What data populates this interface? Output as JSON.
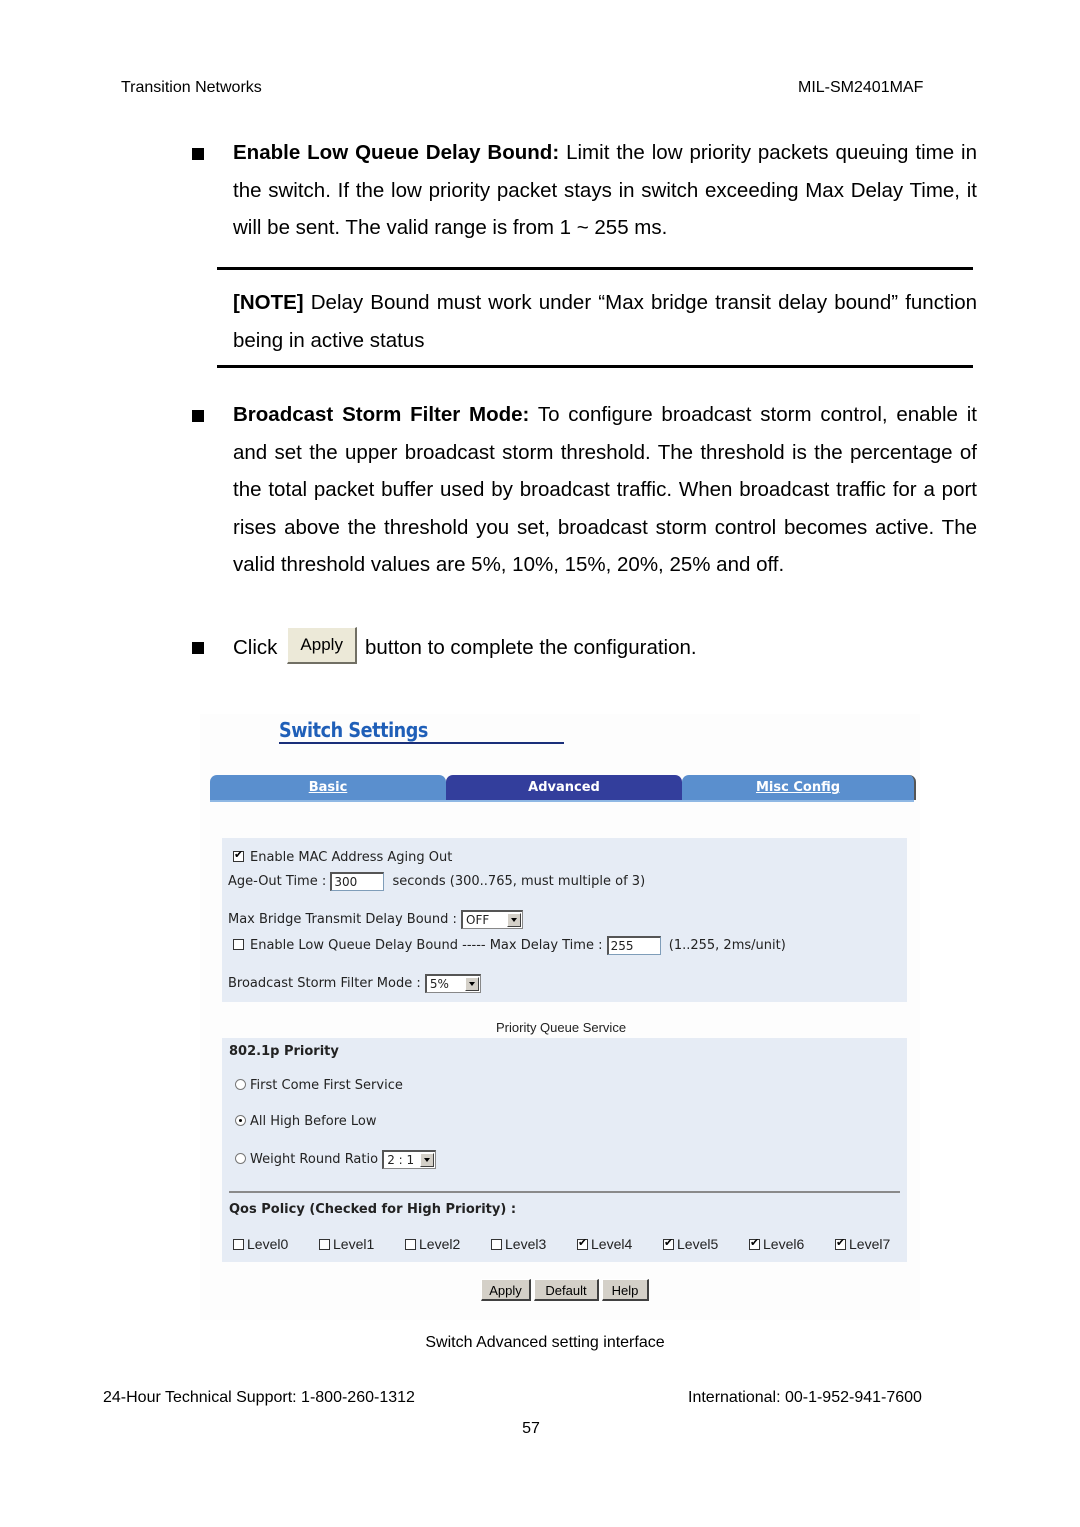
{
  "header": {
    "left": "Transition Networks",
    "right": "MIL-SM2401MAF"
  },
  "sections": {
    "low_queue": {
      "term": "Enable Low Queue Delay Bound:",
      "lines": [
        " Limit the low priority packets queuing time in the switch. If the low priority packet stays in switch exceeding Max Delay Time, it will be sent. The valid range is from 1 ~ 255 ms."
      ]
    },
    "note": {
      "label": "[NOTE]",
      "text": " Delay Bound must work under “Max bridge transit delay bound” function being in active status"
    },
    "storm": {
      "term": "Broadcast Storm Filter Mode:",
      "text": " To configure broadcast storm control, enable it and set the upper broadcast storm threshold. The threshold is the percentage of the total packet buffer used by broadcast traffic. When broadcast traffic for a port rises above the threshold you set, broadcast storm control becomes active. The valid threshold values are 5%, 10%, 15%, 20%, 25% and off."
    },
    "click": {
      "before": "Click",
      "button": "Apply",
      "after": "button to complete the configuration."
    }
  },
  "screenshot": {
    "title": "Switch Settings",
    "tabs": [
      {
        "label": "Basic",
        "active": false
      },
      {
        "label": "Advanced",
        "active": true
      },
      {
        "label": "Misc Config",
        "active": false
      }
    ],
    "mac_aging": {
      "label": "Enable MAC Address Aging Out",
      "checked": true
    },
    "age_out": {
      "label": "Age-Out Time :",
      "value": "300",
      "hint": "seconds (300..765, must multiple of 3)"
    },
    "max_bridge": {
      "label": "Max Bridge Transmit Delay Bound :",
      "value": "OFF"
    },
    "low_queue": {
      "label": "Enable Low Queue Delay Bound ----- Max Delay Time :",
      "checked": false,
      "value": "255",
      "hint": "(1..255, 2ms/unit)"
    },
    "storm": {
      "label": "Broadcast Storm Filter Mode :",
      "value": "5%"
    },
    "pqs_title": "Priority Queue Service",
    "priority_heading": "802.1p Priority",
    "radios": [
      {
        "label": "First Come First Service",
        "selected": false
      },
      {
        "label": "All High Before Low",
        "selected": true
      },
      {
        "label": "Weight Round Ratio",
        "selected": false
      }
    ],
    "ratio_value": "2 : 1",
    "qos_heading": "Qos Policy (Checked for High Priority) :",
    "levels": [
      {
        "label": "Level0",
        "checked": false
      },
      {
        "label": "Level1",
        "checked": false
      },
      {
        "label": "Level2",
        "checked": false
      },
      {
        "label": "Level3",
        "checked": false
      },
      {
        "label": "Level4",
        "checked": true
      },
      {
        "label": "Level5",
        "checked": true
      },
      {
        "label": "Level6",
        "checked": true
      },
      {
        "label": "Level7",
        "checked": true
      }
    ],
    "buttons": {
      "apply": "Apply",
      "default": "Default",
      "help": "Help"
    }
  },
  "caption": "Switch Advanced setting interface",
  "footer": {
    "support": "24-Hour Technical Support: 1-800-260-1312",
    "international": "International: 00-1-952-941-7600",
    "page": "57"
  }
}
